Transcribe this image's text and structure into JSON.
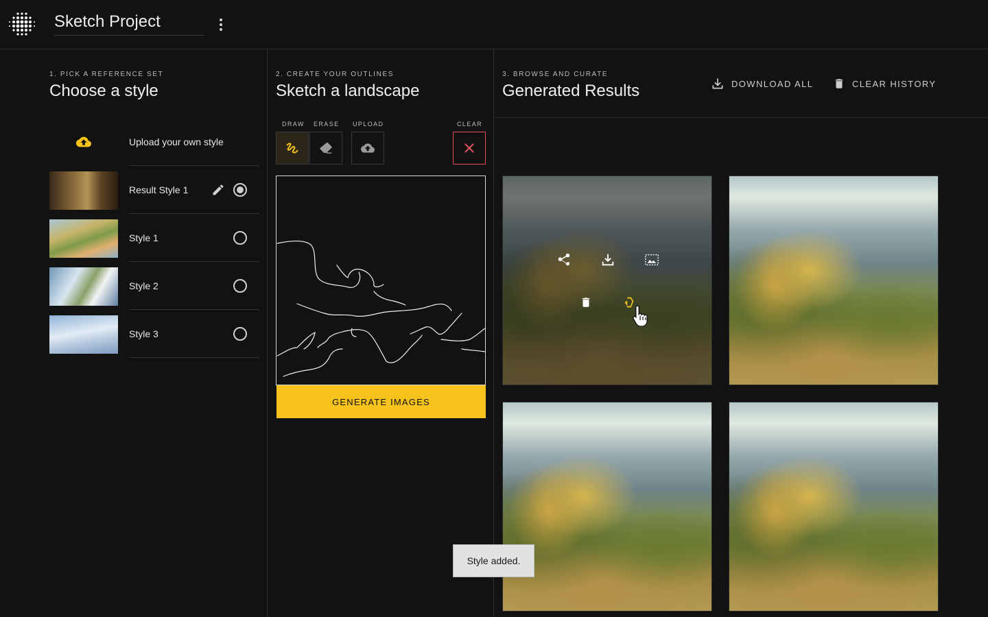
{
  "app": {
    "project_title": "Sketch Project"
  },
  "column1": {
    "step_label": "1. PICK A REFERENCE SET",
    "title": "Choose a style",
    "upload_label": "Upload your own style",
    "styles": [
      {
        "label": "Result Style 1",
        "selected": true,
        "editable": true
      },
      {
        "label": "Style 1",
        "selected": false
      },
      {
        "label": "Style 2",
        "selected": false
      },
      {
        "label": "Style 3",
        "selected": false
      }
    ]
  },
  "column2": {
    "step_label": "2. CREATE YOUR OUTLINES",
    "title": "Sketch a landscape",
    "tools": {
      "draw": "DRAW",
      "erase": "ERASE",
      "upload": "UPLOAD",
      "clear": "CLEAR"
    },
    "generate_label": "GENERATE IMAGES"
  },
  "column3": {
    "step_label": "3. BROWSE AND CURATE",
    "title": "Generated Results",
    "download_all": "DOWNLOAD ALL",
    "clear_history": "CLEAR HISTORY"
  },
  "toast": {
    "message": "Style added."
  },
  "colors": {
    "accent": "#f6c21c",
    "background": "#121212",
    "clear_border": "#e0525f"
  },
  "icons": [
    "dot-grid-logo-icon",
    "more-vert-icon",
    "cloud-upload-icon",
    "pencil-icon",
    "squiggle-draw-icon",
    "eraser-icon",
    "close-icon",
    "download-icon",
    "trash-icon",
    "share-icon",
    "set-as-style-icon",
    "add-to-style-icon",
    "hand-cursor-icon"
  ]
}
